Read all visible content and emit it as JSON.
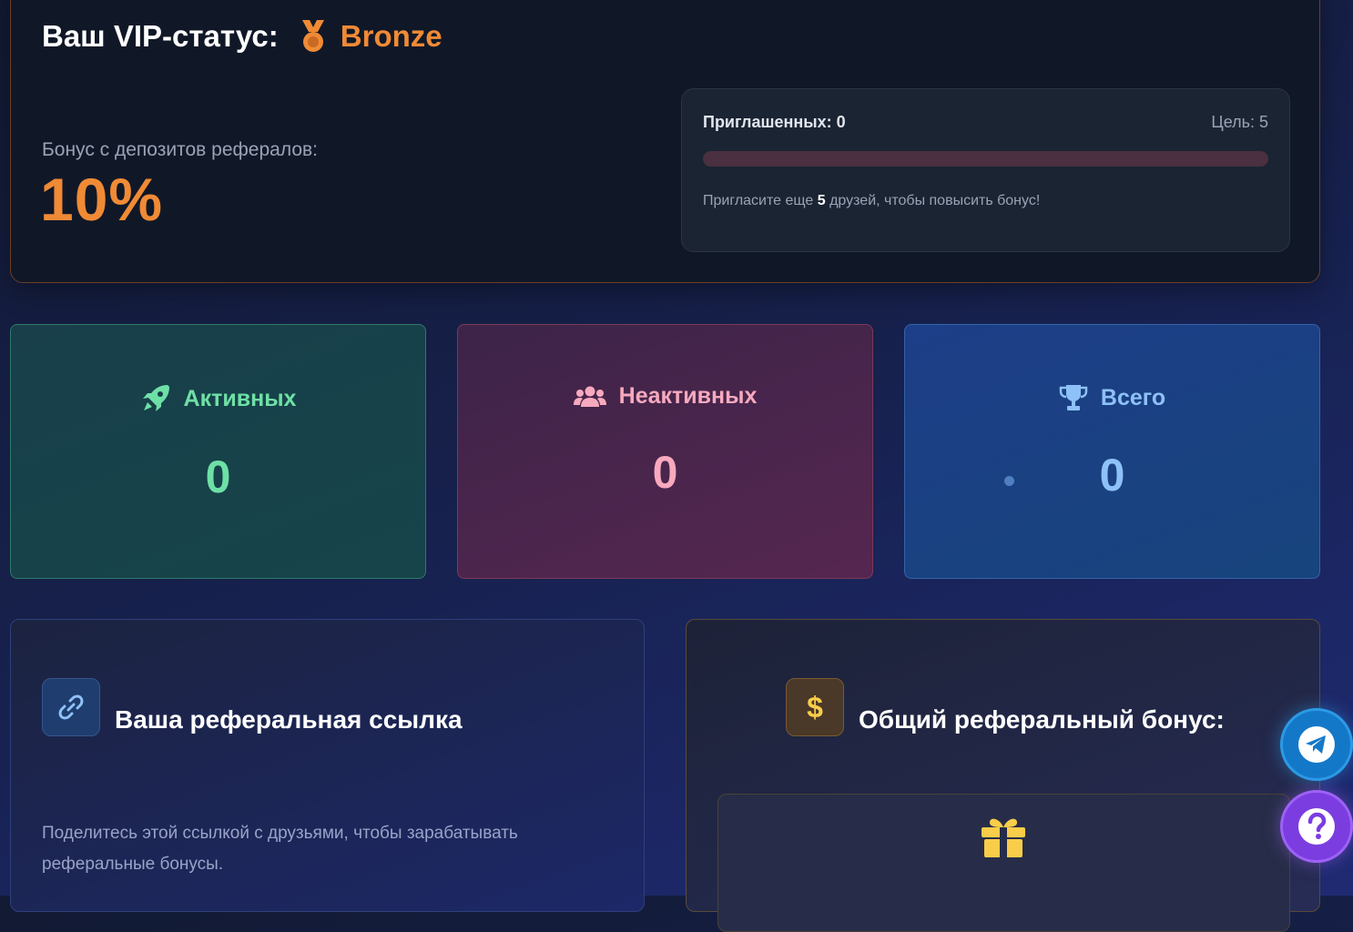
{
  "vip": {
    "title": "Ваш VIP-статус:",
    "level": "Bronze",
    "bonus_label": "Бонус с депозитов рефералов:",
    "bonus_value": "10%",
    "progress": {
      "invited_label": "Приглашенных: 0",
      "goal_label": "Цель: 5",
      "fill_fraction": 0,
      "hint_prefix": "Пригласите еще",
      "hint_count": "5",
      "hint_suffix": "друзей, чтобы повысить бонус!"
    }
  },
  "stats": {
    "active": {
      "label": "Активных",
      "value": "0",
      "icon": "rocket-icon"
    },
    "inactive": {
      "label": "Неактивных",
      "value": "0",
      "icon": "users-icon"
    },
    "total": {
      "label": "Всего",
      "value": "0",
      "icon": "trophy-icon"
    }
  },
  "referral_link": {
    "title": "Ваша реферальная ссылка",
    "description": "Поделитесь этой ссылкой с друзьями, чтобы зарабатывать реферальные бонусы.",
    "icon": "link-icon"
  },
  "referral_bonus": {
    "title": "Общий реферальный бонус:",
    "icon": "dollar-icon",
    "inner_icon": "gift-icon"
  },
  "fabs": {
    "telegram": "telegram-icon",
    "help": "help-icon"
  },
  "colors": {
    "accent_orange": "#f08a35",
    "active_green": "#6ee0a6",
    "inactive_pink": "#f7a9be",
    "total_blue": "#8ec1f7"
  }
}
